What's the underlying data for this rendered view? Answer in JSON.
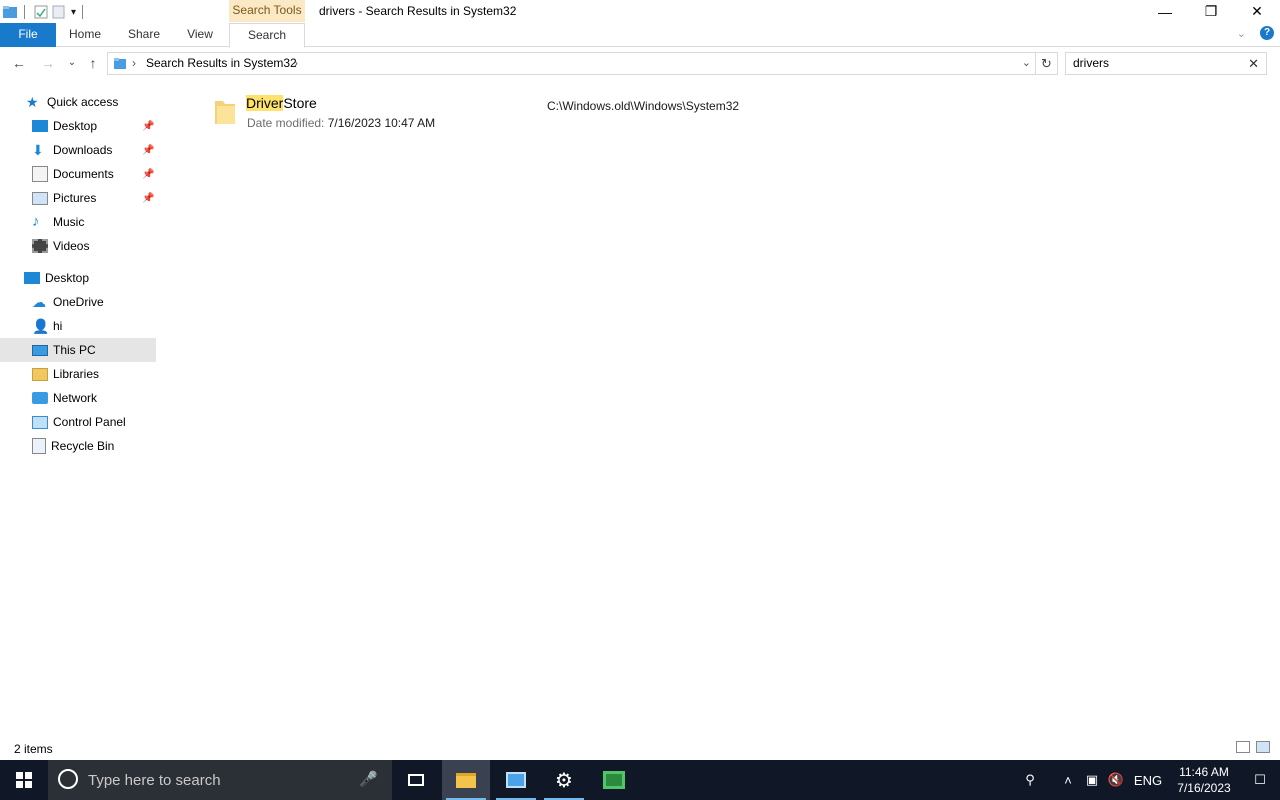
{
  "window": {
    "title": "drivers - Search Results in System32",
    "context_tab": "Search Tools"
  },
  "ribbon": {
    "tabs": [
      "File",
      "Home",
      "Share",
      "View",
      "Search"
    ]
  },
  "address": {
    "breadcrumb": "Search Results in System32"
  },
  "search": {
    "value": "drivers"
  },
  "nav": {
    "items": [
      {
        "label": "Quick access"
      },
      {
        "label": "Desktop"
      },
      {
        "label": "Downloads"
      },
      {
        "label": "Documents"
      },
      {
        "label": "Pictures"
      },
      {
        "label": "Music"
      },
      {
        "label": "Videos"
      },
      {
        "label": "Desktop"
      },
      {
        "label": "OneDrive"
      },
      {
        "label": "hi"
      },
      {
        "label": "This PC"
      },
      {
        "label": "Libraries"
      },
      {
        "label": "Network"
      },
      {
        "label": "Control Panel"
      },
      {
        "label": "Recycle Bin"
      }
    ]
  },
  "results": [
    {
      "name_highlight": "Driver",
      "name_rest": "Store",
      "date_label": "Date modified:",
      "date_value": "7/16/2023 10:47 AM",
      "path": "C:\\Windows.old\\Windows\\System32"
    }
  ],
  "status": {
    "count": "2 items"
  },
  "taskbar": {
    "search_placeholder": "Type here to search",
    "lang": "ENG",
    "time": "11:46 AM",
    "date": "7/16/2023"
  },
  "colors": {
    "accent": "#1979ca",
    "highlight": "#ffe26b",
    "taskbar": "#101827",
    "selected": "#e5e5e5"
  }
}
